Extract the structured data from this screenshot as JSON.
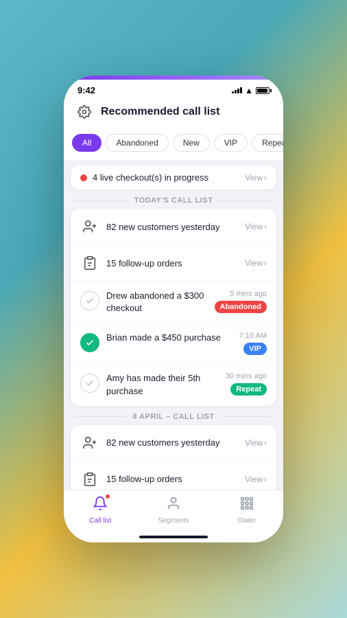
{
  "statusBar": {
    "time": "9:42",
    "signalBars": [
      3,
      5,
      7,
      9,
      11
    ],
    "wifi": "wifi",
    "battery": "battery"
  },
  "header": {
    "title": "Recommended call list",
    "gearIcon": "⚙"
  },
  "filters": {
    "items": [
      {
        "label": "All",
        "active": true
      },
      {
        "label": "Abandoned",
        "active": false
      },
      {
        "label": "New",
        "active": false
      },
      {
        "label": "VIP",
        "active": false
      },
      {
        "label": "Repeat",
        "active": false
      }
    ]
  },
  "liveBanner": {
    "text": "4 live checkout(s) in progress",
    "viewLabel": "View"
  },
  "todaySection": {
    "label": "TODAY'S CALL LIST",
    "rows": [
      {
        "icon": "person-add",
        "text": "82 new customers yesterday",
        "viewLabel": "View"
      },
      {
        "icon": "clipboard",
        "text": "15 follow-up orders",
        "viewLabel": "View"
      }
    ],
    "items": [
      {
        "check": "gray",
        "title": "Drew abandoned a $300 checkout",
        "time": "5 mins ago",
        "badge": "Abandoned",
        "badgeType": "abandoned"
      },
      {
        "check": "green",
        "title": "Brian made a $450 purchase",
        "time": "7:10 AM",
        "badge": "VIP",
        "badgeType": "vip"
      },
      {
        "check": "gray",
        "title": "Amy has made their 5th purchase",
        "time": "30 mins ago",
        "badge": "Repeat",
        "badgeType": "repeat"
      }
    ]
  },
  "aprilSection": {
    "label": "8 APRIL – CALL LIST",
    "rows": [
      {
        "icon": "person-add",
        "text": "82 new customers yesterday",
        "viewLabel": "View"
      },
      {
        "icon": "clipboard",
        "text": "15 follow-up orders",
        "viewLabel": "View"
      }
    ]
  },
  "bottomNav": {
    "items": [
      {
        "label": "Call list",
        "active": true,
        "icon": "bell"
      },
      {
        "label": "Segments",
        "active": false,
        "icon": "person"
      },
      {
        "label": "Dialer",
        "active": false,
        "icon": "dialpad"
      }
    ]
  }
}
